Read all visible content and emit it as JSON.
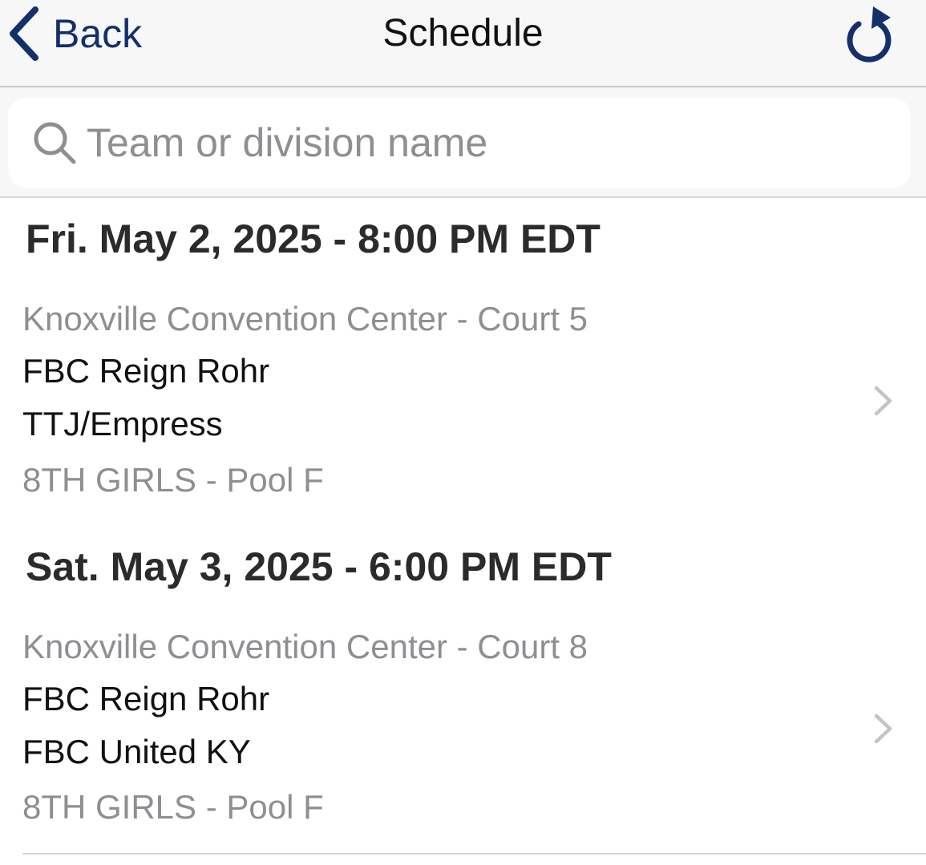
{
  "nav": {
    "back_label": "Back",
    "title": "Schedule",
    "accent_color": "#13306b"
  },
  "search": {
    "placeholder": "Team or division name",
    "value": ""
  },
  "schedule": [
    {
      "date_header": "Fri. May 2, 2025 - 8:00 PM EDT",
      "location": "Knoxville Convention Center  - Court 5",
      "team1": "FBC Reign Rohr",
      "team2": "TTJ/Empress",
      "division": "8TH GIRLS - Pool F"
    },
    {
      "date_header": "Sat. May 3, 2025 - 6:00 PM EDT",
      "location": "Knoxville Convention Center  - Court 8",
      "team1": "FBC Reign Rohr",
      "team2": "FBC United KY",
      "division": "8TH GIRLS - Pool F"
    }
  ]
}
